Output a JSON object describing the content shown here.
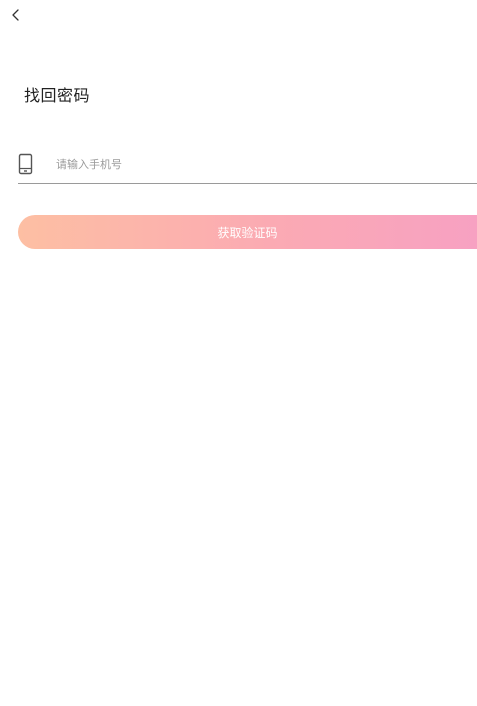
{
  "header": {
    "back_icon": "chevron-left-icon"
  },
  "page": {
    "title": "找回密码"
  },
  "form": {
    "phone_icon": "mobile-phone-icon",
    "phone_value": "",
    "phone_placeholder": "请输入手机号",
    "get_code_label": "获取验证码"
  },
  "colors": {
    "background": "#ffffff",
    "title_text": "#222222",
    "placeholder_text": "#9a9a9a",
    "divider": "#9a9a9a",
    "button_gradient_start": "#fdbfa3",
    "button_gradient_end": "#f7a1c2",
    "button_text": "#ffffff"
  }
}
